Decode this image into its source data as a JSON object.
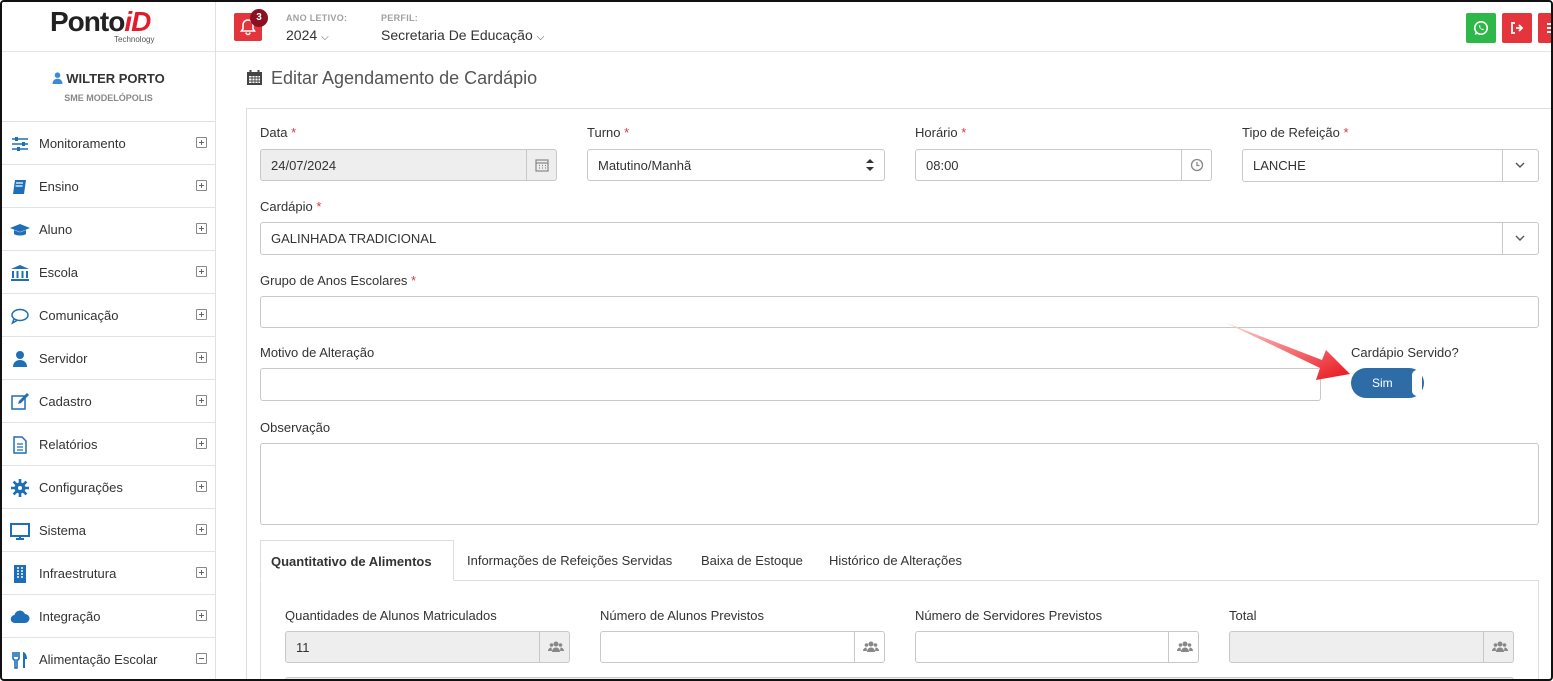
{
  "brand": {
    "logo_text_main": "Ponto",
    "logo_text_accent": "iD",
    "logo_sub": "Technology"
  },
  "header": {
    "notification_count": "3",
    "ano_letivo_label": "ANO LETIVO:",
    "ano_letivo_value": "2024",
    "perfil_label": "PERFIL:",
    "perfil_value": "Secretaria De Educação",
    "colors": {
      "whatsapp": "#2fb84a",
      "logout": "#e4353c",
      "menu": "#e4353c",
      "bell": "#e4353c"
    }
  },
  "sidebar": {
    "user_name": "WILTER PORTO",
    "user_org": "SME MODELÓPOLIS",
    "items": [
      {
        "label": "Monitoramento",
        "icon": "sliders-icon",
        "expanded": false
      },
      {
        "label": "Ensino",
        "icon": "book-icon",
        "expanded": false
      },
      {
        "label": "Aluno",
        "icon": "graduation-cap-icon",
        "expanded": false
      },
      {
        "label": "Escola",
        "icon": "bank-icon",
        "expanded": false
      },
      {
        "label": "Comunicação",
        "icon": "chat-bubble-icon",
        "expanded": false
      },
      {
        "label": "Servidor",
        "icon": "user-icon",
        "expanded": false
      },
      {
        "label": "Cadastro",
        "icon": "edit-icon",
        "expanded": false
      },
      {
        "label": "Relatórios",
        "icon": "document-icon",
        "expanded": false
      },
      {
        "label": "Configurações",
        "icon": "gear-icon",
        "expanded": false
      },
      {
        "label": "Sistema",
        "icon": "monitor-icon",
        "expanded": false
      },
      {
        "label": "Infraestrutura",
        "icon": "building-icon",
        "expanded": false
      },
      {
        "label": "Integração",
        "icon": "cloud-icon",
        "expanded": false
      },
      {
        "label": "Alimentação Escolar",
        "icon": "cutlery-icon",
        "expanded": true
      }
    ]
  },
  "page": {
    "title": "Editar Agendamento de Cardápio"
  },
  "form": {
    "data_label": "Data",
    "data_value": "24/07/2024",
    "turno_label": "Turno",
    "turno_value": "Matutino/Manhã",
    "horario_label": "Horário",
    "horario_value": "08:00",
    "tipo_label": "Tipo de Refeição",
    "tipo_value": "LANCHE",
    "cardapio_label": "Cardápio",
    "cardapio_value": "GALINHADA TRADICIONAL",
    "grupo_label": "Grupo de Anos Escolares",
    "grupo_value": "",
    "motivo_label": "Motivo de Alteração",
    "motivo_value": "",
    "servido_label": "Cardápio Servido?",
    "servido_value": "Sim",
    "observacao_label": "Observação",
    "observacao_value": "",
    "required_mark": "*"
  },
  "tabs": [
    {
      "label": "Quantitativo de Alimentos",
      "active": true
    },
    {
      "label": "Informações de Refeições Servidas",
      "active": false
    },
    {
      "label": "Baixa de Estoque",
      "active": false
    },
    {
      "label": "Histórico de Alterações",
      "active": false
    }
  ],
  "quantitativo": {
    "matriculados_label": "Quantidades de Alunos Matriculados",
    "matriculados_value": "11",
    "previstos_label": "Número de Alunos Previstos",
    "previstos_value": "",
    "servidores_label": "Número de Servidores Previstos",
    "servidores_value": "",
    "total_label": "Total",
    "total_value": ""
  }
}
